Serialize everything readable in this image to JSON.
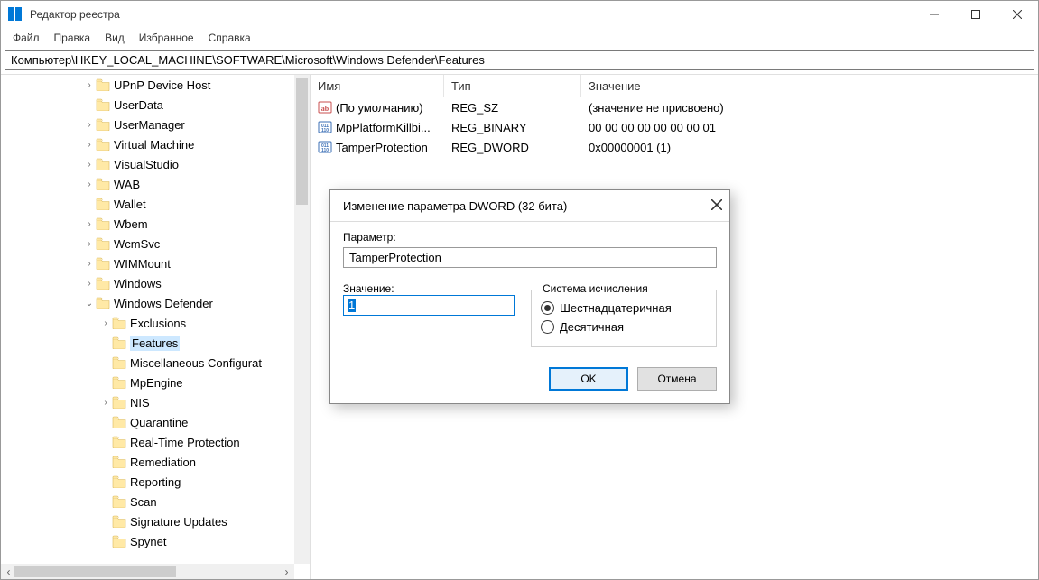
{
  "app_title": "Редактор реестра",
  "menu": [
    "Файл",
    "Правка",
    "Вид",
    "Избранное",
    "Справка"
  ],
  "address": "Компьютер\\HKEY_LOCAL_MACHINE\\SOFTWARE\\Microsoft\\Windows Defender\\Features",
  "tree": [
    {
      "indent": 4,
      "caret": "right",
      "label": "UPnP Device Host"
    },
    {
      "indent": 4,
      "caret": "none",
      "label": "UserData"
    },
    {
      "indent": 4,
      "caret": "right",
      "label": "UserManager"
    },
    {
      "indent": 4,
      "caret": "right",
      "label": "Virtual Machine"
    },
    {
      "indent": 4,
      "caret": "right",
      "label": "VisualStudio"
    },
    {
      "indent": 4,
      "caret": "right",
      "label": "WAB"
    },
    {
      "indent": 4,
      "caret": "none",
      "label": "Wallet"
    },
    {
      "indent": 4,
      "caret": "right",
      "label": "Wbem"
    },
    {
      "indent": 4,
      "caret": "right",
      "label": "WcmSvc"
    },
    {
      "indent": 4,
      "caret": "right",
      "label": "WIMMount"
    },
    {
      "indent": 4,
      "caret": "right",
      "label": "Windows"
    },
    {
      "indent": 4,
      "caret": "down",
      "label": "Windows Defender"
    },
    {
      "indent": 5,
      "caret": "right",
      "label": "Exclusions"
    },
    {
      "indent": 5,
      "caret": "none",
      "label": "Features",
      "selected": true
    },
    {
      "indent": 5,
      "caret": "none",
      "label": "Miscellaneous Configurat"
    },
    {
      "indent": 5,
      "caret": "none",
      "label": "MpEngine"
    },
    {
      "indent": 5,
      "caret": "right",
      "label": "NIS"
    },
    {
      "indent": 5,
      "caret": "none",
      "label": "Quarantine"
    },
    {
      "indent": 5,
      "caret": "none",
      "label": "Real-Time Protection"
    },
    {
      "indent": 5,
      "caret": "none",
      "label": "Remediation"
    },
    {
      "indent": 5,
      "caret": "none",
      "label": "Reporting"
    },
    {
      "indent": 5,
      "caret": "none",
      "label": "Scan"
    },
    {
      "indent": 5,
      "caret": "none",
      "label": "Signature Updates"
    },
    {
      "indent": 5,
      "caret": "none",
      "label": "Spynet"
    }
  ],
  "columns": {
    "name": "Имя",
    "type": "Тип",
    "value": "Значение"
  },
  "values": [
    {
      "icon": "sz",
      "name": "(По умолчанию)",
      "type": "REG_SZ",
      "value": "(значение не присвоено)"
    },
    {
      "icon": "bin",
      "name": "MpPlatformKillbi...",
      "type": "REG_BINARY",
      "value": "00 00 00 00 00 00 00 01"
    },
    {
      "icon": "bin",
      "name": "TamperProtection",
      "type": "REG_DWORD",
      "value": "0x00000001 (1)"
    }
  ],
  "dialog": {
    "title": "Изменение параметра DWORD (32 бита)",
    "param_label": "Параметр:",
    "param_value": "TamperProtection",
    "value_label": "Значение:",
    "value": "1",
    "base_label": "Система исчисления",
    "radio_hex": "Шестнадцатеричная",
    "radio_dec": "Десятичная",
    "ok": "OK",
    "cancel": "Отмена"
  },
  "glyphs": {
    "caret_right": "›",
    "caret_down": "⌄",
    "scroll_left": "‹",
    "scroll_right": "›",
    "close_x": "✕"
  },
  "colors": {
    "accent": "#0078d7",
    "selection": "#cde8ff"
  }
}
